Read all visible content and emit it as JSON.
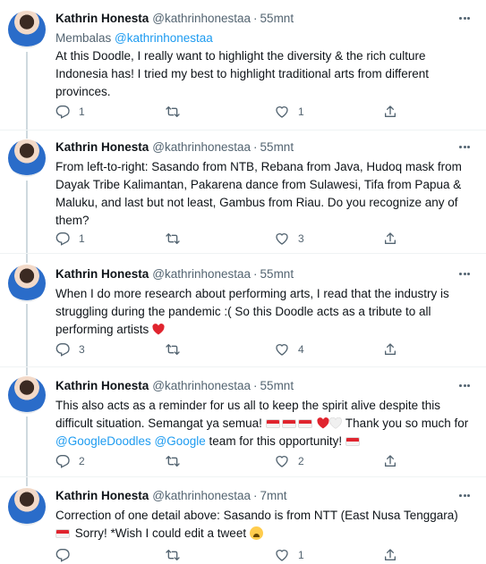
{
  "colors": {
    "accent": "#1d9bf0",
    "heart": "#e0242e",
    "muted": "#536471"
  },
  "author": {
    "name": "Kathrin Honesta",
    "handle": "@kathrinhonestaa",
    "dot": "·"
  },
  "replying": {
    "prefix": "Membalas",
    "handle": "@kathrinhonestaa"
  },
  "tweets": [
    {
      "time": "55mnt",
      "body_1": "At this Doodle, I really want to highlight the diversity & the rich culture Indonesia has! I tried my best to highlight traditional arts from different provinces.",
      "replies": "1",
      "retweets": "",
      "likes": "1"
    },
    {
      "time": "55mnt",
      "body_1": "From left-to-right: Sasando from NTB, Rebana from Java, Hudoq mask from Dayak Tribe Kalimantan, Pakarena dance from Sulawesi, Tifa from Papua & Maluku, and last but not least, Gambus from Riau. Do you recognize any of them?",
      "replies": "1",
      "retweets": "",
      "likes": "3"
    },
    {
      "time": "55mnt",
      "body_1": "When I do more research about performing arts, I read that the industry is struggling during the pandemic :( So this Doodle acts as a tribute to all performing artists",
      "replies": "3",
      "retweets": "",
      "likes": "4"
    },
    {
      "time": "55mnt",
      "body_1": "This also acts as a reminder for us all to keep the spirit alive despite this difficult situation. Semangat ya semua!",
      "body_2": " Thank you so much for ",
      "mention_1": "@GoogleDoodles",
      "mention_2": "@Google",
      "body_3": " team for this opportunity!",
      "replies": "2",
      "retweets": "",
      "likes": "2"
    },
    {
      "time": "7mnt",
      "body_1": "Correction of one detail above: Sasando is from NTT (East Nusa Tenggara)",
      "body_2": " Sorry! *Wish I could edit a tweet ",
      "replies": "",
      "retweets": "",
      "likes": "1"
    }
  ],
  "icons": [
    "reply-icon",
    "retweet-icon",
    "like-icon",
    "share-icon",
    "more-icon"
  ]
}
